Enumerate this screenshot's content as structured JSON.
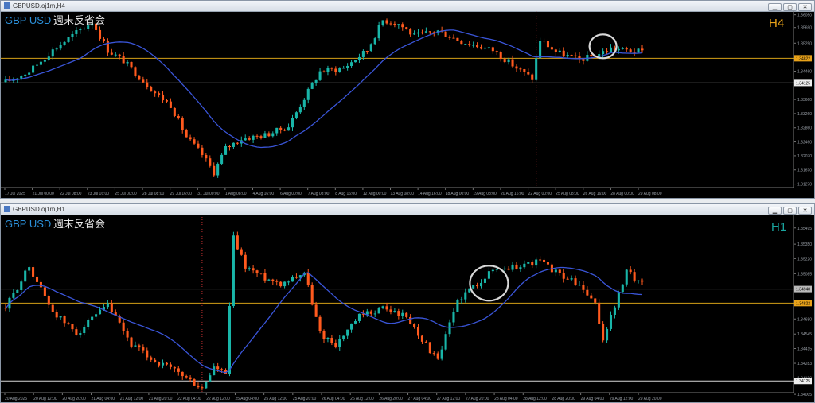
{
  "colors": {
    "bull": "#19b5a8",
    "bear": "#ff5a1e",
    "ma": "#3a55d8",
    "hline_white": "#d8d8d8",
    "hline_gold": "#d4a017",
    "h4_label": "#e8a21a",
    "h1_label": "#1aa6a0",
    "price_tag": "#e8a21a"
  },
  "window_buttons": [
    "▁",
    "▢",
    "✕"
  ],
  "top": {
    "window_title": "GBPUSD.oj1m,H4",
    "symbol_text": "GBP USD",
    "caption": "週末反省会",
    "timeframe": "H4",
    "chart_data": {
      "type": "candlestick",
      "symbol": "GBPUSD",
      "timeframe": "H4",
      "ylim": [
        1.3117,
        1.3611
      ],
      "y_ticks": [
        "1.36050",
        "1.35690",
        "1.35250",
        "1.34822",
        "1.34460",
        "1.34125",
        "1.33660",
        "1.33260",
        "1.32860",
        "1.32460",
        "1.32070",
        "1.31670",
        "1.31270"
      ],
      "x_ticks": [
        "17 Jul 2025",
        "21 Jul 00:00",
        "22 Jul 08:00",
        "23 Jul 16:00",
        "25 Jul 00:00",
        "28 Jul 08:00",
        "29 Jul 16:00",
        "31 Jul 00:00",
        "1 Aug 08:00",
        "4 Aug 16:00",
        "6 Aug 00:00",
        "7 Aug 08:00",
        "8 Aug 16:00",
        "12 Aug 00:00",
        "13 Aug 08:00",
        "14 Aug 16:00",
        "18 Aug 00:00",
        "19 Aug 08:00",
        "20 Aug 16:00",
        "22 Aug 00:00",
        "25 Aug 08:00",
        "26 Aug 16:00",
        "28 Aug 00:00",
        "29 Aug 08:00"
      ],
      "keypoints": [
        [
          0,
          1.3415
        ],
        [
          6,
          1.3445
        ],
        [
          12,
          1.3505
        ],
        [
          18,
          1.3555
        ],
        [
          22,
          1.3585
        ],
        [
          26,
          1.3505
        ],
        [
          30,
          1.3475
        ],
        [
          34,
          1.343
        ],
        [
          38,
          1.3385
        ],
        [
          42,
          1.335
        ],
        [
          46,
          1.326
        ],
        [
          50,
          1.321
        ],
        [
          53,
          1.316
        ],
        [
          56,
          1.3228
        ],
        [
          60,
          1.3255
        ],
        [
          66,
          1.3265
        ],
        [
          72,
          1.329
        ],
        [
          76,
          1.337
        ],
        [
          80,
          1.3445
        ],
        [
          86,
          1.3455
        ],
        [
          92,
          1.3505
        ],
        [
          96,
          1.359
        ],
        [
          100,
          1.358
        ],
        [
          104,
          1.3545
        ],
        [
          110,
          1.356
        ],
        [
          116,
          1.353
        ],
        [
          124,
          1.3505
        ],
        [
          130,
          1.3455
        ],
        [
          134,
          1.3425
        ],
        [
          136,
          1.3535
        ],
        [
          140,
          1.35
        ],
        [
          146,
          1.3478
        ],
        [
          150,
          1.349
        ],
        [
          154,
          1.351
        ],
        [
          158,
          1.3505
        ],
        [
          162,
          1.35
        ]
      ],
      "hlines": [
        {
          "price": 1.34822,
          "color": "gold",
          "label": "1.34822"
        },
        {
          "price": 1.34125,
          "color": "white",
          "label": "1.34125"
        }
      ],
      "ma_period": 20,
      "annotations": [
        {
          "type": "circle",
          "at_bar": 152,
          "price": 1.3516
        },
        {
          "type": "vline",
          "at_bar": 135
        }
      ]
    }
  },
  "bottom": {
    "window_title": "GBPUSD.oj1m,H1",
    "symbol_text": "GBP USD",
    "caption": "週末反省会",
    "timeframe": "H1",
    "chart_data": {
      "type": "candlestick",
      "symbol": "GBPUSD",
      "timeframe": "H1",
      "ylim": [
        1.3402,
        1.356
      ],
      "y_ticks": [
        "1.35495",
        "1.35350",
        "1.35220",
        "1.35085",
        "1.34948",
        "1.34822",
        "1.34680",
        "1.34545",
        "1.34415",
        "1.34283",
        "1.34150",
        "1.34005"
      ],
      "x_ticks": [
        "20 Aug 2025",
        "20 Aug 12:00",
        "20 Aug 20:00",
        "21 Aug 04:00",
        "21 Aug 12:00",
        "21 Aug 20:00",
        "22 Aug 04:00",
        "22 Aug 12:00",
        "25 Aug 04:00",
        "25 Aug 12:00",
        "25 Aug 20:00",
        "26 Aug 04:00",
        "26 Aug 12:00",
        "26 Aug 20:00",
        "27 Aug 04:00",
        "27 Aug 12:00",
        "27 Aug 20:00",
        "28 Aug 04:00",
        "28 Aug 12:00",
        "28 Aug 20:00",
        "29 Aug 04:00",
        "29 Aug 12:00",
        "29 Aug 20:00"
      ],
      "keypoints": [
        [
          0,
          1.3478
        ],
        [
          6,
          1.3515
        ],
        [
          12,
          1.3475
        ],
        [
          18,
          1.3455
        ],
        [
          26,
          1.348
        ],
        [
          32,
          1.3445
        ],
        [
          38,
          1.343
        ],
        [
          44,
          1.342
        ],
        [
          48,
          1.341
        ],
        [
          50,
          1.3405
        ],
        [
          53,
          1.3425
        ],
        [
          56,
          1.3418
        ],
        [
          58,
          1.354
        ],
        [
          61,
          1.3515
        ],
        [
          66,
          1.3505
        ],
        [
          70,
          1.35
        ],
        [
          76,
          1.351
        ],
        [
          80,
          1.3455
        ],
        [
          84,
          1.3445
        ],
        [
          90,
          1.347
        ],
        [
          96,
          1.3478
        ],
        [
          102,
          1.347
        ],
        [
          106,
          1.345
        ],
        [
          110,
          1.343
        ],
        [
          115,
          1.3485
        ],
        [
          120,
          1.35
        ],
        [
          124,
          1.3512
        ],
        [
          130,
          1.3515
        ],
        [
          136,
          1.352
        ],
        [
          140,
          1.351
        ],
        [
          146,
          1.3498
        ],
        [
          150,
          1.348
        ],
        [
          152,
          1.345
        ],
        [
          155,
          1.348
        ],
        [
          158,
          1.351
        ],
        [
          162,
          1.35
        ]
      ],
      "hlines": [
        {
          "price": 1.34948,
          "color": "gray",
          "label": "1.34948"
        },
        {
          "price": 1.34822,
          "color": "gold",
          "label": "1.34822"
        },
        {
          "price": 1.34125,
          "color": "white",
          "label": "1.34125"
        }
      ],
      "ma_period": 20,
      "annotations": [
        {
          "type": "circle",
          "at_bar": 123,
          "price": 1.35
        },
        {
          "type": "vline",
          "at_bar": 50
        }
      ]
    }
  }
}
